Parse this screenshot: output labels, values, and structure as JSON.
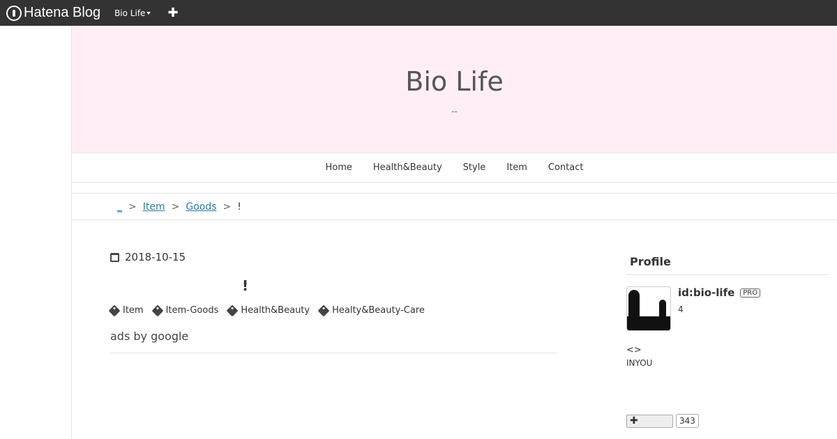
{
  "topbar": {
    "logo_text": "Hatena Blog",
    "blog_menu": "Bio Life",
    "add_symbol": "✚"
  },
  "header": {
    "title": "Bio Life",
    "description": "--"
  },
  "nav": {
    "items": [
      "Home",
      "Health&Beauty",
      "Style",
      "Item",
      "Contact"
    ]
  },
  "breadcrumb": {
    "home": "_",
    "items": [
      "Item",
      "Goods"
    ],
    "current": "!",
    "sep": ">"
  },
  "post": {
    "date": "2018-10-15",
    "title": "!",
    "tags": [
      "Item",
      "Item-Goods",
      "Health&Beauty",
      "Healty&Beauty-Care"
    ],
    "ads": "ads by google"
  },
  "sidebar": {
    "heading": "Profile",
    "user_id": "id:bio-life",
    "badge": "PRO",
    "count": "4",
    "brackets": "<>",
    "text": "INYOU",
    "subscribe_symbol": "✚",
    "subscribe_count": "343"
  },
  "colors": {
    "topbar": "#333333",
    "header_bg": "#ffeef5",
    "link": "#2a7aa8"
  }
}
